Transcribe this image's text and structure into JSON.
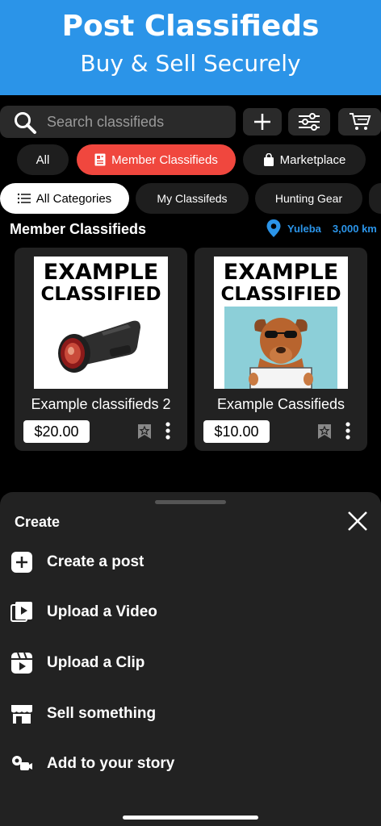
{
  "banner": {
    "title": "Post Classifieds",
    "subtitle": "Buy & Sell Securely"
  },
  "search": {
    "placeholder": "Search classifieds"
  },
  "toolbar": {
    "add_icon": "plus-icon",
    "filter_icon": "sliders-icon",
    "cart_icon": "cart-icon"
  },
  "scope_tabs": [
    {
      "label": "All",
      "selected": false
    },
    {
      "label": "Member Classifieds",
      "selected": true,
      "icon": "newspaper-icon"
    },
    {
      "label": "Marketplace",
      "selected": false,
      "icon": "shopping-bag-icon"
    }
  ],
  "category_tabs": [
    {
      "label": "All Categories",
      "selected": true,
      "icon": "list-icon"
    },
    {
      "label": "My Classifeds",
      "selected": false
    },
    {
      "label": "Hunting Gear",
      "selected": false
    }
  ],
  "section": {
    "title": "Member Classifieds",
    "location": "Yuleba",
    "distance": "3,000 km"
  },
  "listings": [
    {
      "image_line1": "EXAMPLE",
      "image_line2": "CLASSIFIED",
      "title": "Example classifieds 2",
      "price": "$20.00",
      "image_subject": "thermal-monocular"
    },
    {
      "image_line1": "EXAMPLE",
      "image_line2": "CLASSIFIED",
      "title": "Example Cassifieds",
      "price": "$10.00",
      "image_subject": "dog-with-sign"
    }
  ],
  "sheet": {
    "title": "Create",
    "items": [
      {
        "label": "Create a post",
        "icon": "plus-square-icon"
      },
      {
        "label": "Upload a Video",
        "icon": "video-icon"
      },
      {
        "label": "Upload a Clip",
        "icon": "clip-icon"
      },
      {
        "label": "Sell something",
        "icon": "storefront-icon"
      },
      {
        "label": "Add to your story",
        "icon": "story-camera-icon"
      }
    ]
  },
  "colors": {
    "accent_blue": "#2b94e8",
    "accent_red": "#f0473e",
    "surface": "#222222",
    "background": "#000000"
  }
}
